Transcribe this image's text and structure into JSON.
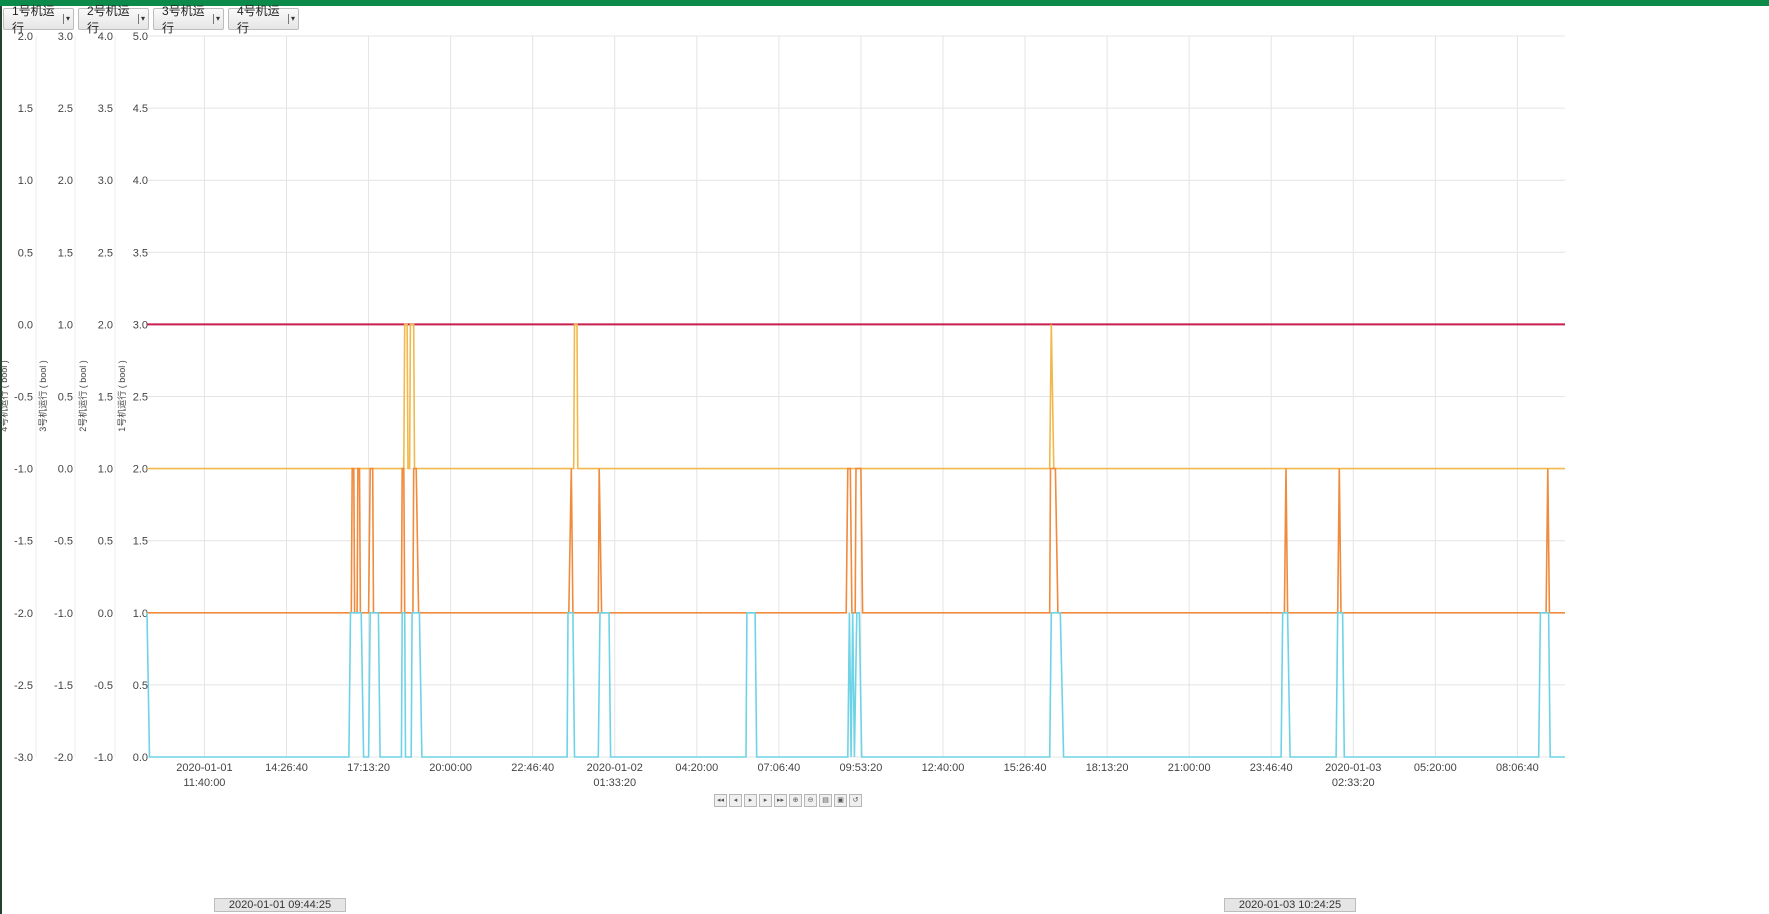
{
  "toolbar": {
    "series_buttons": [
      {
        "label": "1号机运行"
      },
      {
        "label": "2号机运行"
      },
      {
        "label": "3号机运行"
      },
      {
        "label": "4号机运行"
      }
    ]
  },
  "range": {
    "start_label": "2020-01-01 09:44:25",
    "end_label": "2020-01-03 10:24:25"
  },
  "navigator": {
    "icons": [
      "first-icon",
      "prev-icon",
      "play-icon",
      "next-icon",
      "last-icon",
      "zoom-in-icon",
      "zoom-out-icon",
      "print-icon",
      "save-icon",
      "reset-icon"
    ]
  },
  "colors": {
    "series1": "#f2b84b",
    "series2": "#f2a259",
    "series3": "#f08a3c",
    "series4": "#6ed3e6",
    "flat_line": "#c81d4d",
    "grid": "#e4e4e4",
    "topbar": "#0b8a4a"
  },
  "chart_data": {
    "type": "line",
    "x_ticks": [
      {
        "label": "2020-01-01\n11:40:00",
        "t": 7000
      },
      {
        "label": "14:26:40",
        "t": 17000
      },
      {
        "label": "17:13:20",
        "t": 27000
      },
      {
        "label": "20:00:00",
        "t": 37000
      },
      {
        "label": "22:46:40",
        "t": 47000
      },
      {
        "label": "2020-01-02\n01:33:20",
        "t": 57000
      },
      {
        "label": "04:20:00",
        "t": 67000
      },
      {
        "label": "07:06:40",
        "t": 77000
      },
      {
        "label": "09:53:20",
        "t": 87000
      },
      {
        "label": "12:40:00",
        "t": 97000
      },
      {
        "label": "15:26:40",
        "t": 107000
      },
      {
        "label": "18:13:20",
        "t": 117000
      },
      {
        "label": "21:00:00",
        "t": 127000
      },
      {
        "label": "23:46:40",
        "t": 137000
      },
      {
        "label": "2020-01-03\n02:33:20",
        "t": 147000
      },
      {
        "label": "05:20:00",
        "t": 157000
      },
      {
        "label": "08:06:40",
        "t": 167000
      }
    ],
    "x_range": [
      0,
      172800
    ],
    "y_axes": [
      {
        "title": "4号机运行 ( bool )",
        "ticks": [
          "2.0",
          "1.5",
          "1.0",
          "0.5",
          "0.0",
          "-0.5",
          "-1.0",
          "-1.5",
          "-2.0",
          "-2.5",
          "-3.0"
        ],
        "range": [
          -3,
          2
        ]
      },
      {
        "title": "3号机运行 ( bool )",
        "ticks": [
          "3.0",
          "2.5",
          "2.0",
          "1.5",
          "1.0",
          "0.5",
          "0.0",
          "-0.5",
          "-1.0",
          "-1.5",
          "-2.0"
        ],
        "range": [
          -2,
          3
        ]
      },
      {
        "title": "2号机运行 ( bool )",
        "ticks": [
          "4.0",
          "3.5",
          "3.0",
          "2.5",
          "2.0",
          "1.5",
          "1.0",
          "0.5",
          "0.0",
          "-0.5",
          "-1.0"
        ],
        "range": [
          -1,
          4
        ]
      },
      {
        "title": "1号机运行 ( bool )",
        "ticks": [
          "5.0",
          "4.5",
          "4.0",
          "3.5",
          "3.0",
          "2.5",
          "2.0",
          "1.5",
          "1.0",
          "0.5",
          "0.0"
        ],
        "range": [
          0,
          5
        ]
      }
    ],
    "grid": true,
    "series": [
      {
        "color": "#c81d4d",
        "points": [
          [
            0,
            3
          ],
          [
            172800,
            3
          ]
        ]
      },
      {
        "color": "#f2b84b",
        "points": [
          [
            0,
            2
          ],
          [
            31300,
            2
          ],
          [
            31400,
            3
          ],
          [
            31700,
            3
          ],
          [
            31800,
            2
          ],
          [
            32000,
            2
          ],
          [
            32100,
            3
          ],
          [
            32500,
            3
          ],
          [
            32600,
            2
          ],
          [
            52000,
            2
          ],
          [
            52100,
            3
          ],
          [
            52400,
            3
          ],
          [
            52500,
            2
          ],
          [
            110000,
            2
          ],
          [
            110200,
            3
          ],
          [
            110500,
            2
          ],
          [
            172800,
            2
          ]
        ]
      },
      {
        "color": "#f08a3c",
        "points": [
          [
            0,
            1
          ],
          [
            24900,
            1
          ],
          [
            25000,
            2
          ],
          [
            25200,
            2
          ],
          [
            25300,
            1
          ],
          [
            25600,
            1
          ],
          [
            25700,
            2
          ],
          [
            25900,
            2
          ],
          [
            26000,
            1
          ],
          [
            27000,
            1
          ],
          [
            27200,
            2
          ],
          [
            27500,
            2
          ],
          [
            27600,
            1
          ],
          [
            31000,
            1
          ],
          [
            31100,
            2
          ],
          [
            31300,
            2
          ],
          [
            31400,
            1
          ],
          [
            32400,
            1
          ],
          [
            32500,
            2
          ],
          [
            32800,
            2
          ],
          [
            33100,
            1
          ],
          [
            51400,
            1
          ],
          [
            51700,
            2
          ],
          [
            51900,
            1
          ],
          [
            55000,
            1
          ],
          [
            55100,
            2
          ],
          [
            55400,
            1
          ],
          [
            85200,
            1
          ],
          [
            85400,
            2
          ],
          [
            85700,
            2
          ],
          [
            85900,
            1
          ],
          [
            86300,
            1
          ],
          [
            86400,
            2
          ],
          [
            87000,
            2
          ],
          [
            87200,
            1
          ],
          [
            110000,
            1
          ],
          [
            110100,
            2
          ],
          [
            110700,
            2
          ],
          [
            111000,
            1
          ],
          [
            138600,
            1
          ],
          [
            138800,
            2
          ],
          [
            139000,
            1
          ],
          [
            145100,
            1
          ],
          [
            145300,
            2
          ],
          [
            145500,
            1
          ],
          [
            170500,
            1
          ],
          [
            170700,
            2
          ],
          [
            170900,
            1
          ],
          [
            172800,
            1
          ]
        ]
      },
      {
        "color": "#6ed3e6",
        "points": [
          [
            0,
            1
          ],
          [
            300,
            0
          ],
          [
            24600,
            0
          ],
          [
            24800,
            1
          ],
          [
            26100,
            1
          ],
          [
            26400,
            0
          ],
          [
            27000,
            0
          ],
          [
            27200,
            1
          ],
          [
            28200,
            1
          ],
          [
            28400,
            0
          ],
          [
            31000,
            0
          ],
          [
            31100,
            1
          ],
          [
            31400,
            1
          ],
          [
            31500,
            0
          ],
          [
            32200,
            0
          ],
          [
            32300,
            1
          ],
          [
            33200,
            1
          ],
          [
            33500,
            0
          ],
          [
            51200,
            0
          ],
          [
            51300,
            1
          ],
          [
            51900,
            1
          ],
          [
            52100,
            0
          ],
          [
            55000,
            0
          ],
          [
            55200,
            1
          ],
          [
            56300,
            1
          ],
          [
            56500,
            0
          ],
          [
            73000,
            0
          ],
          [
            73100,
            1
          ],
          [
            74100,
            1
          ],
          [
            74300,
            0
          ],
          [
            85400,
            0
          ],
          [
            85600,
            1
          ],
          [
            85800,
            0
          ],
          [
            86000,
            1
          ],
          [
            86200,
            0
          ],
          [
            86500,
            1
          ],
          [
            86800,
            1
          ],
          [
            87100,
            0
          ],
          [
            110000,
            0
          ],
          [
            110200,
            1
          ],
          [
            111300,
            1
          ],
          [
            111700,
            0
          ],
          [
            138200,
            0
          ],
          [
            138400,
            1
          ],
          [
            139000,
            1
          ],
          [
            139300,
            0
          ],
          [
            144900,
            0
          ],
          [
            145100,
            1
          ],
          [
            145700,
            1
          ],
          [
            145900,
            0
          ],
          [
            169600,
            0
          ],
          [
            169800,
            1
          ],
          [
            170800,
            1
          ],
          [
            171000,
            0
          ],
          [
            172800,
            0
          ]
        ]
      }
    ]
  }
}
